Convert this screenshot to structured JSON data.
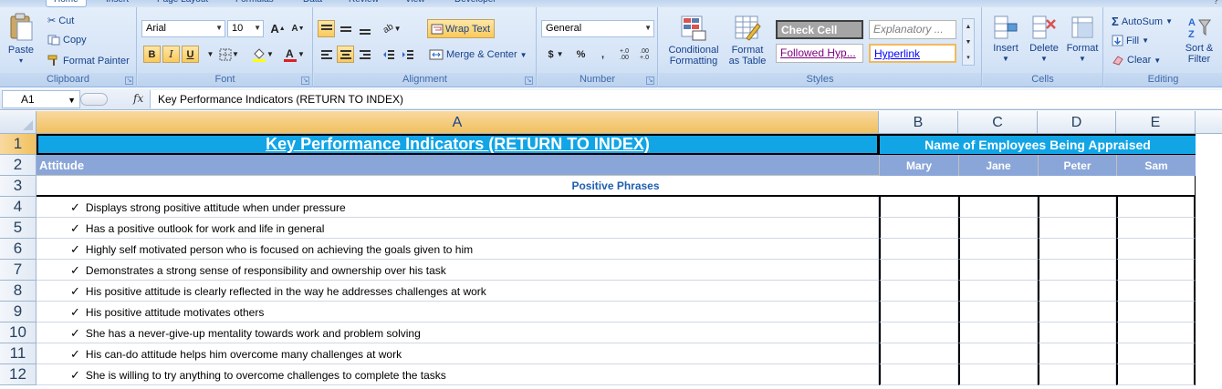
{
  "ribbon": {
    "tabs": [
      "Home",
      "Insert",
      "Page Layout",
      "Formulas",
      "Data",
      "Review",
      "View",
      "Developer"
    ],
    "clipboard": {
      "group": "Clipboard",
      "paste": "Paste",
      "cut": "Cut",
      "copy": "Copy",
      "format_painter": "Format Painter"
    },
    "font": {
      "group": "Font",
      "family": "Arial",
      "size": "10",
      "grow": "A",
      "shrink": "A",
      "bold": "B",
      "italic": "I",
      "underline": "U"
    },
    "alignment": {
      "group": "Alignment",
      "wrap_text": "Wrap Text",
      "merge_center": "Merge & Center"
    },
    "number": {
      "group": "Number",
      "format": "General",
      "currency": "$",
      "percent": "%",
      "comma": ",",
      "inc_decimal": "+.0 .00",
      "dec_decimal": ".00 +.0"
    },
    "styles": {
      "group": "Styles",
      "conditional": [
        "Conditional",
        "Formatting"
      ],
      "format_table": [
        "Format",
        "as Table"
      ],
      "cells": [
        "Check Cell",
        "Explanatory ...",
        "Followed Hyp...",
        "Hyperlink"
      ]
    },
    "cells": {
      "group": "Cells",
      "insert": "Insert",
      "delete": "Delete",
      "format": "Format"
    },
    "editing": {
      "group": "Editing",
      "autosum": "AutoSum",
      "fill": "Fill",
      "clear": "Clear",
      "sort": [
        "Sort &",
        "Filter"
      ]
    },
    "colors": {
      "accent": "#15428b",
      "ribbon_bg": "#dbe8f7"
    }
  },
  "formula_bar": {
    "name_box": "A1",
    "fx": "fx",
    "content": "Key Performance Indicators (RETURN TO INDEX)"
  },
  "sheet": {
    "columns": [
      "A",
      "B",
      "C",
      "D",
      "E"
    ],
    "rows": [
      "1",
      "2",
      "3",
      "4",
      "5",
      "6",
      "7",
      "8",
      "9",
      "10",
      "11",
      "12"
    ],
    "title": "Key Performance Indicators (RETURN TO INDEX)",
    "employees_header": "Name of Employees Being Appraised",
    "category": "Attitude",
    "employees": [
      "Mary",
      "Jane",
      "Peter",
      "Sam"
    ],
    "section": "Positive Phrases",
    "check": "✓",
    "phrases": [
      "Displays strong positive attitude when under pressure",
      "Has a positive outlook for work and life in general",
      "Highly self motivated person who is focused on achieving the goals given to him",
      "Demonstrates a strong sense of responsibility and ownership over his task",
      "His positive attitude is clearly reflected in the way he addresses challenges at work",
      "His positive attitude motivates others",
      "She has a never-give-up mentality towards work and problem solving",
      "His can-do attitude helps him overcome many challenges at work",
      "She is willing to try anything to overcome challenges to complete the tasks"
    ],
    "colors": {
      "title_bg": "#12a5e6",
      "header_bg": "#8aa6d8",
      "section_text": "#1f5fb1"
    }
  }
}
